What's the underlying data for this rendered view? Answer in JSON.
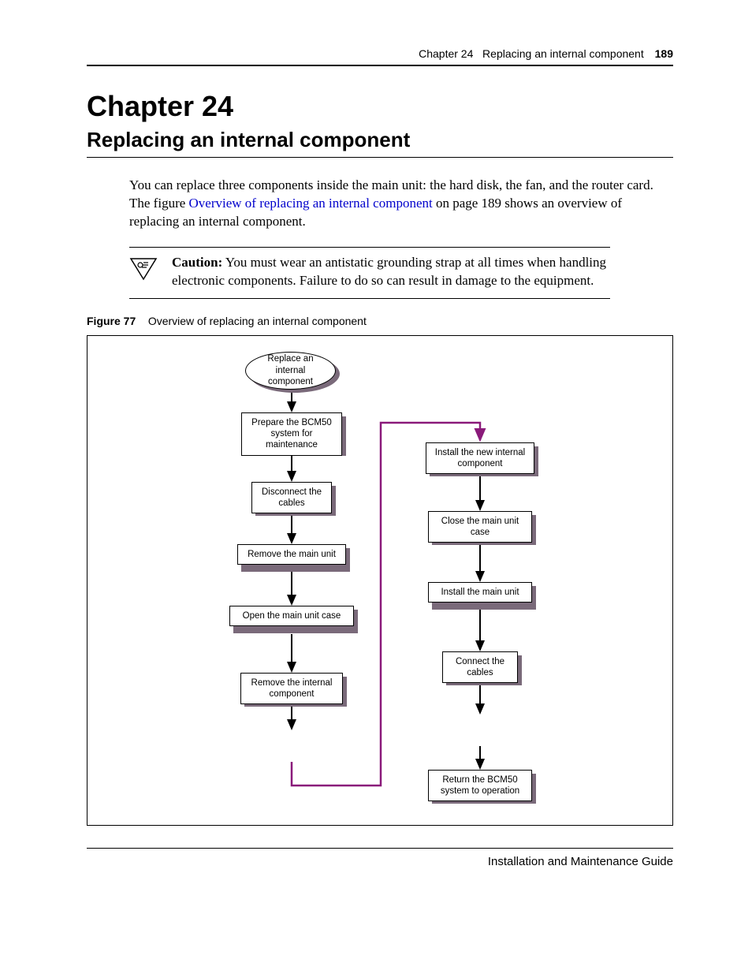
{
  "header": {
    "chapter_ref": "Chapter 24",
    "title_ref": "Replacing an internal component",
    "page_number": "189"
  },
  "chapter": {
    "number": "Chapter 24",
    "title": "Replacing an internal component"
  },
  "intro": {
    "before_link": "You can replace three components inside the main unit: the hard disk, the fan, and the router card. The figure ",
    "link_text": "Overview of replacing an internal component",
    "after_link": " on page 189 shows an overview of replacing an internal component."
  },
  "caution": {
    "label": "Caution:",
    "text": " You must wear an antistatic grounding strap at all times when handling electronic components. Failure to do so can result in damage to the equipment."
  },
  "figure": {
    "label": "Figure 77",
    "caption": "Overview of replacing an internal component"
  },
  "chart_data": {
    "type": "flowchart",
    "title": "Overview of replacing an internal component",
    "nodes": [
      {
        "id": "n0",
        "shape": "ellipse",
        "text": "Replace an internal component"
      },
      {
        "id": "n1",
        "shape": "box",
        "text": "Prepare the BCM50 system for maintenance"
      },
      {
        "id": "n2",
        "shape": "box",
        "text": "Disconnect the cables"
      },
      {
        "id": "n3",
        "shape": "box",
        "text": "Remove the main unit"
      },
      {
        "id": "n4",
        "shape": "box",
        "text": "Open the main unit case"
      },
      {
        "id": "n5",
        "shape": "box",
        "text": "Remove the internal component"
      },
      {
        "id": "n6",
        "shape": "box",
        "text": "Install the new internal component"
      },
      {
        "id": "n7",
        "shape": "box",
        "text": "Close the main unit case"
      },
      {
        "id": "n8",
        "shape": "box",
        "text": "Install the main unit"
      },
      {
        "id": "n9",
        "shape": "box",
        "text": "Connect the cables"
      },
      {
        "id": "n10",
        "shape": "box",
        "text": "Return the BCM50 system to operation"
      }
    ],
    "edges": [
      [
        "n0",
        "n1"
      ],
      [
        "n1",
        "n2"
      ],
      [
        "n2",
        "n3"
      ],
      [
        "n3",
        "n4"
      ],
      [
        "n4",
        "n5"
      ],
      [
        "n5",
        "n6"
      ],
      [
        "n6",
        "n7"
      ],
      [
        "n7",
        "n8"
      ],
      [
        "n8",
        "n9"
      ],
      [
        "n9",
        "n10"
      ]
    ]
  },
  "footer": {
    "text": "Installation and Maintenance Guide"
  }
}
